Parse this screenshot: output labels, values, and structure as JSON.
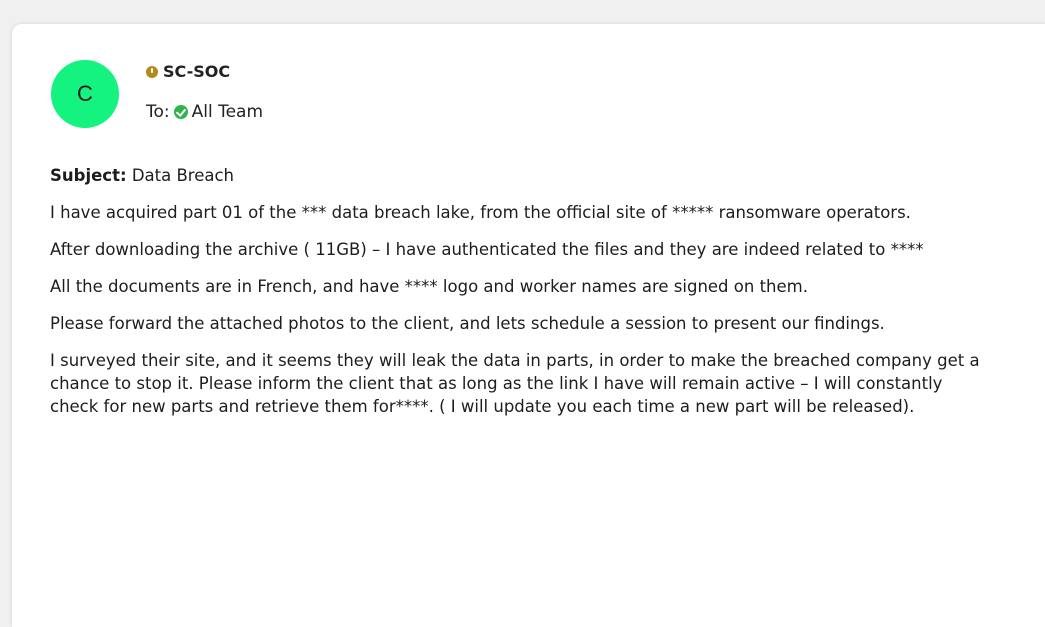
{
  "email": {
    "avatar_letter": "C",
    "sender": "SC-SOC",
    "to_label": "To:",
    "recipient": "All Team",
    "subject_label": "Subject:",
    "subject": "Data Breach",
    "paragraphs": [
      "I have acquired part 01 of the *** data breach lake, from the official site of ***** ransomware operators.",
      "After downloading the archive ( 11GB) – I have authenticated the files and they are indeed related to ****",
      "All the documents are in French, and have **** logo and worker names are signed on them.",
      "Please forward the attached photos to the client, and lets schedule a session to present our findings.",
      "I surveyed their site, and it seems they will leak the data in parts, in order to make the breached company get a chance to stop it. Please inform the client that as long as the link I have will remain active – I will constantly check for new parts and retrieve them for****. ( I will update you each time a new part will be released)."
    ]
  },
  "colors": {
    "avatar_bg": "#14f27f",
    "sender_dot": "#b08b1e",
    "check_icon": "#2fb34a",
    "page_bg": "#f0f0f0"
  },
  "icons": {
    "sender_status": "clock-icon",
    "recipient_status": "check-circle-icon"
  }
}
